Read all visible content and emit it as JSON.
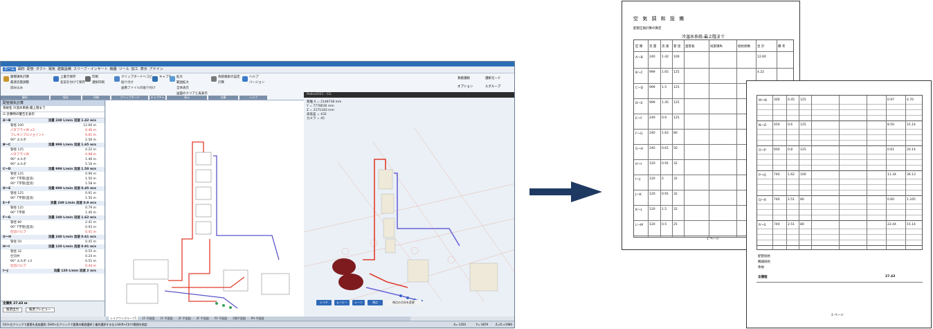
{
  "app": {
    "menu": [
      "ホーム",
      "図形",
      "配管",
      "ダクト",
      "電気",
      "建築設備",
      "スリーブ・インサート",
      "機器",
      "ツール",
      "加工",
      "表示",
      "アドイン"
    ],
    "ribbon": {
      "groups": [
        {
          "label": "解析",
          "items": [
            "摩擦損失計算",
            "最適流量調整",
            "読み込み"
          ]
        },
        {
          "label": "保存",
          "items": [
            "上書き保存",
            "名前を付けて保存"
          ]
        },
        {
          "label": "印刷",
          "items": [
            "印刷",
            "選択印刷"
          ]
        },
        {
          "label": "クリップボード",
          "items": [
            "クリップボードへコピー",
            "貼り付け",
            "画像ファイルの貼り付け"
          ]
        },
        {
          "label": "キャプチャ",
          "items": [
            "キャプチャ"
          ]
        },
        {
          "label": "表示",
          "items": [
            "拡大",
            "範囲拡大",
            "全体表示",
            "画面のクリアと再表示"
          ]
        },
        {
          "label": "計算",
          "items": [
            "系統検索の設定",
            "計算"
          ]
        },
        {
          "label": "ヘルプ",
          "items": [
            "ヘルプ",
            "バージョン"
          ]
        }
      ],
      "right_items": [
        "系統選択",
        "選択モード",
        "オプション",
        "ルグループ"
      ]
    },
    "panel": {
      "title": "配管損失計算",
      "combo": "系統名 冷温水系統-最上階まで",
      "checkbox_label": "計算時の警告を表示",
      "rows": [
        {
          "label": "A～B",
          "value": "流量 249 L/min 流速 1.42 m/s",
          "group": true
        },
        {
          "label": "管径 100",
          "value": "12.60 m",
          "group": false
        },
        {
          "label": "バタフライ弁 ×2",
          "value": "0.46 m",
          "group": false,
          "red": true
        },
        {
          "label": "フレキシブルジョイント",
          "value": "0.61 m",
          "group": false,
          "red": true
        },
        {
          "label": "90° エルボ",
          "value": "2.56 m",
          "group": false
        },
        {
          "label": "B～C",
          "value": "流量 999 L/min 流速 1.65 m/s",
          "group": true
        },
        {
          "label": "管径 125",
          "value": "4.22 m",
          "group": false
        },
        {
          "label": "バタフライ弁",
          "value": "0.98 m",
          "group": false,
          "red": true
        },
        {
          "label": "90° エルボ",
          "value": "1.46 m",
          "group": false
        },
        {
          "label": "90° エルボ",
          "value": "5.16 m",
          "group": false
        },
        {
          "label": "C～D",
          "value": "流量 999 L/min 流速 1.50 m/s",
          "group": true
        },
        {
          "label": "管径 125",
          "value": "0.96 m",
          "group": false
        },
        {
          "label": "90° T字管(直流)",
          "value": "1.50 m",
          "group": false
        },
        {
          "label": "90° T字管(直流)",
          "value": "1.58 m",
          "group": false
        },
        {
          "label": "D～E",
          "value": "流量 999 L/min 流速 0.45 m/s",
          "group": true
        },
        {
          "label": "管径 125",
          "value": "0.91 m",
          "group": false
        },
        {
          "label": "90° T字管(直流)",
          "value": "1.50 m",
          "group": false
        },
        {
          "label": "E～F",
          "value": "流量 249 L/min 流速 0.9 m/s",
          "group": true
        },
        {
          "label": "管径 125",
          "value": "0.79 m",
          "group": false
        },
        {
          "label": "90° T字管",
          "value": "1.40 m",
          "group": false
        },
        {
          "label": "F～G",
          "value": "流量 240 L/min 流速 1.62 m/s",
          "group": true
        },
        {
          "label": "管径 80",
          "value": "2.41 m",
          "group": false
        },
        {
          "label": "90° T字管(直流)",
          "value": "0.93 m",
          "group": false
        },
        {
          "label": "仕切バルブ",
          "value": "0.41 m",
          "group": false,
          "red": true
        },
        {
          "label": "G～H",
          "value": "流量 240 L/min 流速 0.61 m/s",
          "group": true
        },
        {
          "label": "管径 50",
          "value": "0.45 m",
          "group": false
        },
        {
          "label": "H～I",
          "value": "流量 120 L/min 流速 0.91 m/s",
          "group": true
        },
        {
          "label": "管径 32",
          "value": "0.55 m",
          "group": false
        },
        {
          "label": "仕切弁",
          "value": "0.24 m",
          "group": false
        },
        {
          "label": "90° エルボ ×3",
          "value": "0.51 m",
          "group": false
        },
        {
          "label": "仕切バルブ",
          "value": "0.44 m",
          "group": false,
          "red": true
        },
        {
          "label": "I～J",
          "value": "流量 120 L/min 流速 2 m/s",
          "group": true
        }
      ],
      "total": "全損失 27.43 m",
      "footer_buttons": [
        "帳票出力",
        "帳票プレビュー"
      ]
    },
    "render": {
      "title": "Rebro2021 - CG",
      "info_lines": [
        "距離 X = 2148738 mm",
        "Y = 7778630 mm",
        "Z = 2171183 mm",
        "高低差 = 432",
        "カメラ = 45"
      ],
      "buttons": [
        "レイヤ",
        "ムービー",
        "シーン",
        "視点",
        "視点の方向を変更"
      ]
    },
    "tabs": [
      "レイアウトグループ1",
      "1F 平面図",
      "1F 平面図",
      "2F 平面図",
      "3F 平面図",
      "RF 平面図",
      "2階平面図",
      "PH 平面図"
    ],
    "status": "Ctrl+左クリックで要素を追加選択, Shift+左クリックで要素の範囲選択 | 複合選択するならShift+Ctrlで範囲を指定",
    "status_right": [
      "X=-1350",
      "Y=-1879",
      "Z=FL+1980"
    ],
    "colors": {
      "supply_pipe": "#e23b2a",
      "return_pipe": "#5a55c8",
      "ribbon_accent": "#2d6fb6",
      "arrow": "#1e3a63"
    }
  },
  "sheet1": {
    "title": "空 気 調 和 設 備",
    "subtitle": "配管圧損計算の算定",
    "system": "冷温水系統-最上階まで",
    "col_headers": [
      "区 間",
      "流 量",
      "流 速",
      "管 径",
      "直管長",
      "局部損失",
      "抵抗係数",
      "合 計",
      "備 考"
    ],
    "page": "1 ページ",
    "rows": [
      [
        "A～B",
        "240",
        "1.42",
        "100",
        "",
        "",
        "",
        "12.60",
        ""
      ],
      [
        "B～C",
        "999",
        "1.65",
        "125",
        "",
        "",
        "",
        "4.22",
        ""
      ],
      [
        "C～D",
        "999",
        "1.5",
        "125",
        "",
        "",
        "",
        "0.96",
        ""
      ],
      [
        "D～E",
        "999",
        "1.45",
        "125",
        "",
        "",
        "",
        "0.91",
        ""
      ],
      [
        "E～F",
        "249",
        "0.9",
        "125",
        "",
        "",
        "",
        "0.79",
        ""
      ],
      [
        "F～G",
        "240",
        "1.62",
        "80",
        "",
        "",
        "",
        "2.41",
        ""
      ],
      [
        "G～H",
        "240",
        "0.61",
        "50",
        "",
        "",
        "",
        "0.45",
        ""
      ],
      [
        "H～I",
        "120",
        "0.91",
        "32",
        "",
        "",
        "",
        "0.55",
        ""
      ],
      [
        "I～J",
        "120",
        "2",
        "32",
        "",
        "",
        "",
        "",
        ""
      ],
      [
        "J～K",
        "120",
        "0.91",
        "32",
        "",
        "",
        "",
        "",
        ""
      ],
      [
        "K～L",
        "120",
        "1.5",
        "32",
        "",
        "",
        "",
        "",
        ""
      ],
      [
        "L～M",
        "120",
        "0.5",
        "25",
        "",
        "",
        "",
        "",
        ""
      ]
    ]
  },
  "sheet2": {
    "rows": [
      [
        "M～N",
        "300",
        "0.45",
        "125",
        "",
        "",
        "",
        "0.97",
        "4.70"
      ],
      [
        "N～O",
        "450",
        "0.6",
        "125",
        "",
        "",
        "",
        "8.50",
        "15.14"
      ],
      [
        "O～P",
        "600",
        "0.8",
        "125",
        "",
        "",
        "",
        "0.61",
        "20.14"
      ],
      [
        "P～Q",
        "740",
        "1.62",
        "100",
        "",
        "",
        "",
        "11.34",
        "36.13"
      ],
      [
        "Q～R",
        "740",
        "2.51",
        "80",
        "",
        "",
        "",
        "0.60",
        "1.245"
      ],
      [
        "R～S",
        "740",
        "2.51",
        "80",
        "",
        "",
        "",
        "22.44",
        "15.14"
      ]
    ],
    "summary": [
      "配管抵抗",
      "機器抵抗",
      "余裕",
      "全揚程"
    ],
    "total": "27.43",
    "page": "2 ページ"
  }
}
